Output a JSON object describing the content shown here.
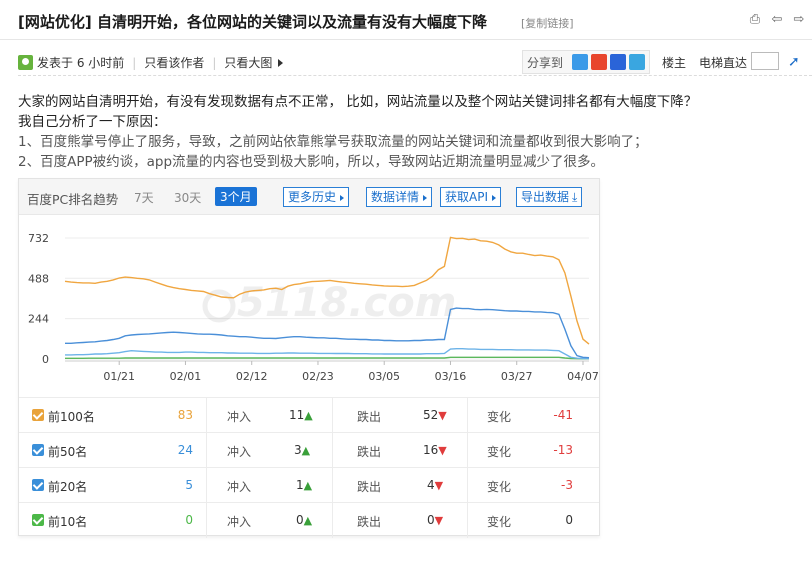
{
  "post": {
    "tag": "[网站优化]",
    "title": "自清明开始，各位网站的关键词以及流量有没有大幅度下降",
    "copy_link": "[复制链接]"
  },
  "meta": {
    "posted": "发表于 6 小时前",
    "only_author": "只看该作者",
    "big_image": "只看大图",
    "share_label": "分享到",
    "floor_owner": "楼主",
    "elevator": "电梯直达"
  },
  "body": {
    "line1": "大家的网站自清明开始，有没有发现数据有点不正常，  比如，网站流量以及整个网站关键词排名都有大幅度下降？",
    "line2": "我自己分析了一下原因：",
    "line3": "1、百度熊掌号停止了服务，导致，之前网站依靠熊掌号获取流量的网站关键词和流量都收到很大影响了；",
    "line4": "2、百度APP被约谈，app流量的内容也受到极大影响，所以，导致网站近期流量明显减少了很多。"
  },
  "chart_header": {
    "title": "百度PC排名趋势",
    "ranges": [
      "7天",
      "30天",
      "3个月"
    ],
    "active_range": "3个月",
    "links": [
      "更多历史",
      "数据详情",
      "获取API",
      "导出数据"
    ]
  },
  "chart_data": {
    "type": "line",
    "y_ticks": [
      0,
      244,
      488,
      732
    ],
    "ylim": [
      0,
      780
    ],
    "x_tick_labels": [
      "01/21",
      "02/01",
      "02/12",
      "02/23",
      "03/05",
      "03/16",
      "03/27",
      "04/07"
    ],
    "x_tick_index": [
      9,
      20,
      31,
      42,
      53,
      64,
      75,
      86
    ],
    "n_points": 88,
    "series": [
      {
        "color": "#f0a640",
        "values": [
          470,
          465,
          462,
          460,
          460,
          458,
          465,
          470,
          478,
          490,
          495,
          492,
          488,
          485,
          478,
          465,
          452,
          440,
          432,
          425,
          420,
          415,
          412,
          408,
          395,
          385,
          375,
          372,
          370,
          392,
          405,
          412,
          415,
          418,
          425,
          428,
          420,
          440,
          450,
          455,
          462,
          468,
          470,
          472,
          475,
          470,
          465,
          462,
          458,
          455,
          452,
          448,
          445,
          442,
          440,
          440,
          438,
          440,
          445,
          460,
          475,
          500,
          540,
          560,
          735,
          728,
          730,
          722,
          725,
          715,
          712,
          705,
          690,
          665,
          648,
          640,
          640,
          632,
          625,
          628,
          622,
          618,
          600,
          520,
          380,
          230,
          120,
          90
        ]
      },
      {
        "color": "#4a8fd8",
        "values": [
          95,
          95,
          98,
          100,
          102,
          104,
          108,
          112,
          118,
          125,
          140,
          145,
          148,
          150,
          152,
          155,
          158,
          160,
          162,
          160,
          158,
          155,
          152,
          150,
          150,
          148,
          145,
          140,
          138,
          135,
          135,
          132,
          128,
          125,
          125,
          124,
          128,
          132,
          135,
          135,
          132,
          130,
          128,
          128,
          125,
          125,
          122,
          120,
          120,
          118,
          118,
          115,
          115,
          112,
          112,
          110,
          110,
          110,
          112,
          112,
          115,
          115,
          118,
          118,
          300,
          308,
          305,
          305,
          300,
          298,
          300,
          298,
          295,
          292,
          290,
          290,
          288,
          288,
          285,
          285,
          282,
          280,
          270,
          180,
          80,
          20,
          10,
          8
        ]
      },
      {
        "color": "#6db3e8",
        "values": [
          25,
          25,
          26,
          26,
          28,
          30,
          30,
          32,
          35,
          38,
          45,
          50,
          48,
          46,
          44,
          42,
          42,
          40,
          40,
          40,
          42,
          42,
          40,
          40,
          38,
          38,
          38,
          36,
          36,
          35,
          35,
          35,
          34,
          34,
          34,
          35,
          35,
          36,
          36,
          35,
          35,
          35,
          34,
          34,
          34,
          33,
          33,
          33,
          32,
          32,
          32,
          31,
          31,
          30,
          30,
          30,
          30,
          30,
          30,
          30,
          32,
          32,
          32,
          34,
          60,
          62,
          62,
          60,
          60,
          58,
          58,
          58,
          56,
          56,
          56,
          55,
          55,
          55,
          54,
          54,
          54,
          52,
          50,
          30,
          10,
          5,
          3,
          2
        ]
      },
      {
        "color": "#5cb85c",
        "values": [
          4,
          4,
          4,
          4,
          5,
          5,
          5,
          5,
          5,
          5,
          6,
          6,
          6,
          6,
          6,
          6,
          6,
          6,
          6,
          6,
          6,
          6,
          6,
          6,
          6,
          6,
          6,
          6,
          6,
          6,
          6,
          6,
          6,
          6,
          6,
          6,
          6,
          6,
          6,
          6,
          6,
          6,
          6,
          6,
          6,
          6,
          6,
          6,
          6,
          6,
          6,
          6,
          6,
          6,
          6,
          6,
          6,
          6,
          6,
          6,
          6,
          6,
          6,
          6,
          10,
          10,
          10,
          10,
          10,
          10,
          10,
          10,
          10,
          10,
          10,
          10,
          10,
          10,
          10,
          10,
          10,
          10,
          10,
          6,
          3,
          2,
          1,
          1
        ]
      }
    ]
  },
  "stats": [
    {
      "name": "前100名",
      "count": "83",
      "color": "#e9a33b",
      "in_label": "冲入",
      "in_value": "11",
      "out_label": "跌出",
      "out_value": "52",
      "chg_label": "变化",
      "chg_value": "-41",
      "chg_color": "#e03c3c"
    },
    {
      "name": "前50名",
      "count": "24",
      "color": "#3a8fd9",
      "in_label": "冲入",
      "in_value": "3",
      "out_label": "跌出",
      "out_value": "16",
      "chg_label": "变化",
      "chg_value": "-13",
      "chg_color": "#e03c3c"
    },
    {
      "name": "前20名",
      "count": "5",
      "color": "#3a8fd9",
      "in_label": "冲入",
      "in_value": "1",
      "out_label": "跌出",
      "out_value": "4",
      "chg_label": "变化",
      "chg_value": "-3",
      "chg_color": "#e03c3c"
    },
    {
      "name": "前10名",
      "count": "0",
      "color": "#4cb848",
      "in_label": "冲入",
      "in_value": "0",
      "out_label": "跌出",
      "out_value": "0",
      "chg_label": "变化",
      "chg_value": "0",
      "chg_color": "#333333"
    }
  ],
  "icons": {
    "up": "▲",
    "down": "▼"
  }
}
